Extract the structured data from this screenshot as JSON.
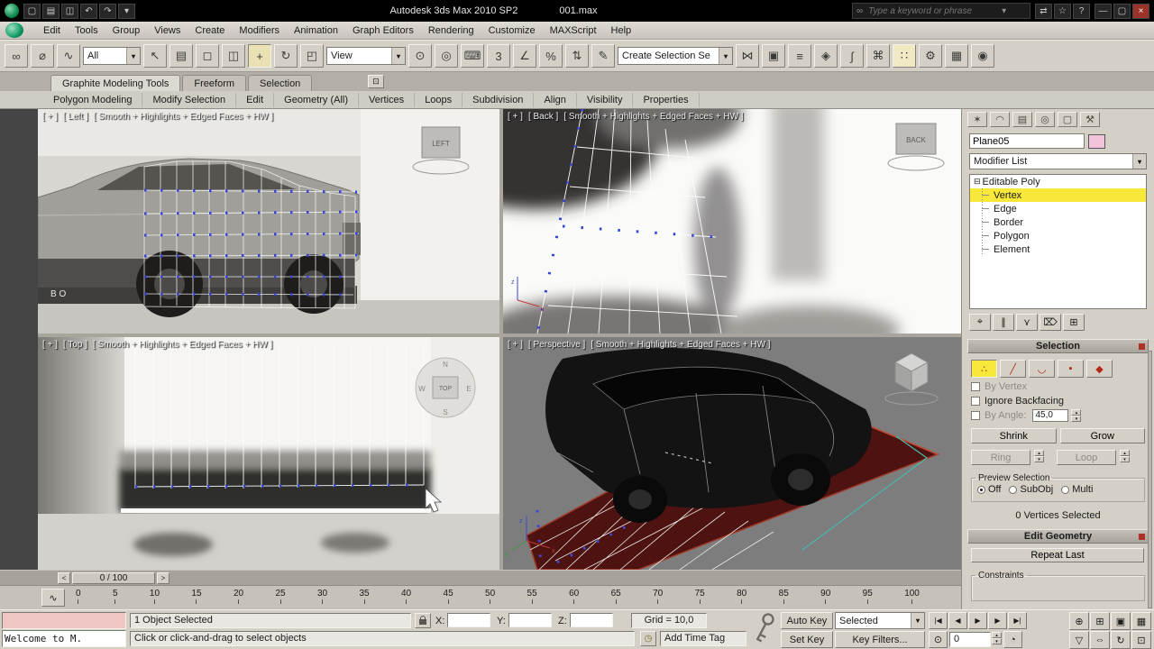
{
  "icons": {
    "dropdown_arrow": "▾",
    "spinner_up": "▴",
    "spinner_down": "▾"
  },
  "title_bar": {
    "app_title": "Autodesk 3ds Max  2010 SP2",
    "file_name": "001.max",
    "search_placeholder": "Type a keyword or phrase",
    "search_icon_glyph": "∞",
    "search_dropdown_glyph": "▾",
    "quick_icons": [
      {
        "name": "new-file-icon",
        "glyph": "▢"
      },
      {
        "name": "open-file-icon",
        "glyph": "▤"
      },
      {
        "name": "save-file-icon",
        "glyph": "◫"
      },
      {
        "name": "undo-icon",
        "glyph": "↶"
      },
      {
        "name": "redo-icon",
        "glyph": "↷"
      },
      {
        "name": "workspace-dropdown-icon",
        "glyph": "▾"
      }
    ],
    "right_icons": [
      {
        "name": "communication-center-icon",
        "glyph": "⇄"
      },
      {
        "name": "favorites-icon",
        "glyph": "☆"
      },
      {
        "name": "help-icon",
        "glyph": "?"
      }
    ],
    "window_controls": [
      {
        "name": "minimize-button",
        "glyph": "—"
      },
      {
        "name": "restore-button",
        "glyph": "▢"
      },
      {
        "name": "close-button",
        "glyph": "×",
        "cls": "close"
      }
    ]
  },
  "menu": {
    "items": [
      "Edit",
      "Tools",
      "Group",
      "Views",
      "Create",
      "Modifiers",
      "Animation",
      "Graph Editors",
      "Rendering",
      "Customize",
      "MAXScript",
      "Help"
    ]
  },
  "toolbar": {
    "filter_value": "All",
    "coord_value": "View",
    "selection_set_value": "Create Selection Se",
    "seg1": [
      {
        "name": "select-and-link-icon",
        "glyph": "∞"
      },
      {
        "name": "unlink-selection-icon",
        "glyph": "⌀"
      },
      {
        "name": "bind-to-space-warp-icon",
        "glyph": "∿"
      }
    ],
    "seg2": [
      {
        "name": "select-object-icon",
        "glyph": "↖"
      },
      {
        "name": "select-by-name-icon",
        "glyph": "▤"
      },
      {
        "name": "rectangular-selection-icon",
        "glyph": "◻"
      },
      {
        "name": "window-crossing-icon",
        "glyph": "◫"
      },
      {
        "name": "select-and-move-icon",
        "glyph": "+",
        "cls": "pressed"
      },
      {
        "name": "select-and-rotate-icon",
        "glyph": "↻"
      },
      {
        "name": "select-and-scale-icon",
        "glyph": "◰"
      }
    ],
    "seg3": [
      {
        "name": "use-pivot-center-icon",
        "glyph": "⊙"
      },
      {
        "name": "select-and-manipulate-icon",
        "glyph": "◎"
      },
      {
        "name": "keyboard-override-icon",
        "glyph": "⌨"
      },
      {
        "name": "snaps-toggle-icon",
        "glyph": "3"
      },
      {
        "name": "angle-snap-icon",
        "glyph": "∠"
      },
      {
        "name": "percent-snap-icon",
        "glyph": "%"
      },
      {
        "name": "spinner-snap-icon",
        "glyph": "⇅"
      },
      {
        "name": "named-selection-sets-icon",
        "glyph": "✎"
      }
    ],
    "seg4": [
      {
        "name": "mirror-icon",
        "glyph": "⋈"
      },
      {
        "name": "align-icon",
        "glyph": "▣"
      },
      {
        "name": "layer-manager-icon",
        "glyph": "≡"
      },
      {
        "name": "graphite-toggle-icon",
        "glyph": "◈"
      },
      {
        "name": "curve-editor-icon",
        "glyph": "∫"
      },
      {
        "name": "schematic-view-icon",
        "glyph": "⌘"
      },
      {
        "name": "material-editor-icon",
        "glyph": "∷",
        "cls": "hl"
      },
      {
        "name": "render-setup-icon",
        "glyph": "⚙"
      },
      {
        "name": "rendered-frame-icon",
        "glyph": "▦"
      },
      {
        "name": "render-production-icon",
        "glyph": "◉"
      }
    ]
  },
  "ribbon": {
    "minimize_glyph": "⊡",
    "tabs": [
      {
        "name": "tab-graphite-modeling-tools",
        "label": "Graphite Modeling Tools",
        "cls": "active"
      },
      {
        "name": "tab-freeform",
        "label": "Freeform"
      },
      {
        "name": "tab-selection",
        "label": "Selection"
      }
    ],
    "panels": [
      "Polygon Modeling",
      "Modify Selection",
      "Edit",
      "Geometry (All)",
      "Vertices",
      "Loops",
      "Subdivision",
      "Align",
      "Visibility",
      "Properties"
    ]
  },
  "viewports": {
    "left": {
      "plus": "[ + ]",
      "name": "[ Left ]",
      "shading": "[ Smooth + Highlights + Edged Faces + HW ]",
      "cube_label": "LEFT",
      "blueprint_mark": "B O"
    },
    "back": {
      "plus": "[ + ]",
      "name": "[ Back ]",
      "shading": "[ Smooth + Highlights + Edged Faces + HW ]",
      "cube_label": "BACK",
      "axis_x": "x",
      "axis_z": "z"
    },
    "top": {
      "plus": "[ + ]",
      "name": "[ Top ]",
      "shading": "[ Smooth + Highlights + Edged Faces + HW ]",
      "cube_label": "TOP",
      "compass": {
        "n": "N",
        "e": "E",
        "s": "S",
        "w": "W"
      }
    },
    "perspective": {
      "plus": "[ + ]",
      "name": "[ Perspective ]",
      "shading": "[ Smooth + Highlights + Edged Faces + HW ]",
      "axis_x": "x",
      "axis_y": "y",
      "axis_z": "z"
    }
  },
  "timeline": {
    "slider_value": "0 / 100",
    "prev_glyph": "<",
    "next_glyph": ">",
    "trackbar_icon_glyph": "∿",
    "ticks": [
      "0",
      "5",
      "10",
      "15",
      "20",
      "25",
      "30",
      "35",
      "40",
      "45",
      "50",
      "55",
      "60",
      "65",
      "70",
      "75",
      "80",
      "85",
      "90",
      "95",
      "100"
    ]
  },
  "status_bar": {
    "listener_text": "Welcome to M.",
    "selection_status": "1 Object Selected",
    "prompt": "Click or click-and-drag to select objects",
    "time_tag": "Add Time Tag",
    "time_tag_icon_glyph": "◷",
    "x_label": "X:",
    "y_label": "Y:",
    "z_label": "Z:",
    "grid_value": "Grid = 10,0",
    "auto_key": "Auto Key",
    "set_key": "Set Key",
    "selected_value": "Selected",
    "key_filters": "Key Filters...",
    "frame_value": "0",
    "key_mode_glyph": "⊙",
    "time_config_glyph": "◔",
    "playback": [
      {
        "name": "go-to-start-button",
        "glyph": "|◀"
      },
      {
        "name": "previous-frame-button",
        "glyph": "◀"
      },
      {
        "name": "play-button",
        "glyph": "▶"
      },
      {
        "name": "next-frame-button",
        "glyph": "▶"
      },
      {
        "name": "go-to-end-button",
        "glyph": "▶|"
      }
    ],
    "nav": [
      {
        "name": "zoom-icon",
        "glyph": "⊕"
      },
      {
        "name": "zoom-all-icon",
        "glyph": "⊞"
      },
      {
        "name": "zoom-extents-icon",
        "glyph": "▣"
      },
      {
        "name": "zoom-extents-all-icon",
        "glyph": "▦"
      },
      {
        "name": "field-of-view-icon",
        "glyph": "▽"
      },
      {
        "name": "pan-icon",
        "glyph": "⇔"
      },
      {
        "name": "orbit-icon",
        "glyph": "↻"
      },
      {
        "name": "maximize-viewport-icon",
        "glyph": "⊡"
      }
    ]
  },
  "command_panel": {
    "tabs": [
      {
        "name": "create-tab-icon",
        "glyph": "✶"
      },
      {
        "name": "modify-tab-icon",
        "glyph": "◠"
      },
      {
        "name": "hierarchy-tab-icon",
        "glyph": "▤"
      },
      {
        "name": "motion-tab-icon",
        "glyph": "◎"
      },
      {
        "name": "display-tab-icon",
        "glyph": "▢"
      },
      {
        "name": "utilities-tab-icon",
        "glyph": "⚒"
      }
    ],
    "object_name": "Plane05",
    "modifier_list_label": "Modifier List",
    "stack": [
      {
        "name": "stack-editable-poly",
        "label": "Editable Poly",
        "prefix": "⊟",
        "cls": "root"
      },
      {
        "name": "stack-vertex",
        "label": "Vertex",
        "cls": "child selected"
      },
      {
        "name": "stack-edge",
        "label": "Edge",
        "cls": "child"
      },
      {
        "name": "stack-border",
        "label": "Border",
        "cls": "child"
      },
      {
        "name": "stack-polygon",
        "label": "Polygon",
        "cls": "child"
      },
      {
        "name": "stack-element",
        "label": "Element",
        "cls": "child"
      }
    ],
    "stack_buttons": [
      {
        "name": "pin-stack-icon",
        "glyph": "⌖"
      },
      {
        "name": "show-end-result-icon",
        "glyph": "∥"
      },
      {
        "name": "make-unique-icon",
        "glyph": "⋎"
      },
      {
        "name": "remove-modifier-icon",
        "glyph": "⌦"
      },
      {
        "name": "configure-modifier-sets-icon",
        "glyph": "⊞"
      }
    ],
    "selection_rollout": {
      "title": "Selection",
      "subobject": [
        {
          "name": "vertex-subobject-icon",
          "glyph": "∴",
          "cls": "pressed"
        },
        {
          "name": "edge-subobject-icon",
          "glyph": "╱"
        },
        {
          "name": "border-subobject-icon",
          "glyph": "◡"
        },
        {
          "name": "polygon-subobject-icon",
          "glyph": "▪"
        },
        {
          "name": "element-subobject-icon",
          "glyph": "◆"
        }
      ],
      "by_vertex": "By Vertex",
      "ignore_backfacing": "Ignore Backfacing",
      "by_angle": "By Angle:",
      "by_angle_value": "45,0",
      "shrink": "Shrink",
      "grow": "Grow",
      "ring": "Ring",
      "loop": "Loop",
      "preview_title": "Preview Selection",
      "preview_options": [
        {
          "name": "preview-off-radio",
          "label": "Off",
          "cls": "on"
        },
        {
          "name": "preview-subobj-radio",
          "label": "SubObj"
        },
        {
          "name": "preview-multi-radio",
          "label": "Multi"
        }
      ],
      "status": "0 Vertices Selected"
    },
    "edit_geometry_rollout": {
      "title": "Edit Geometry",
      "repeat_last": "Repeat Last",
      "constraints_title": "Constraints"
    }
  }
}
